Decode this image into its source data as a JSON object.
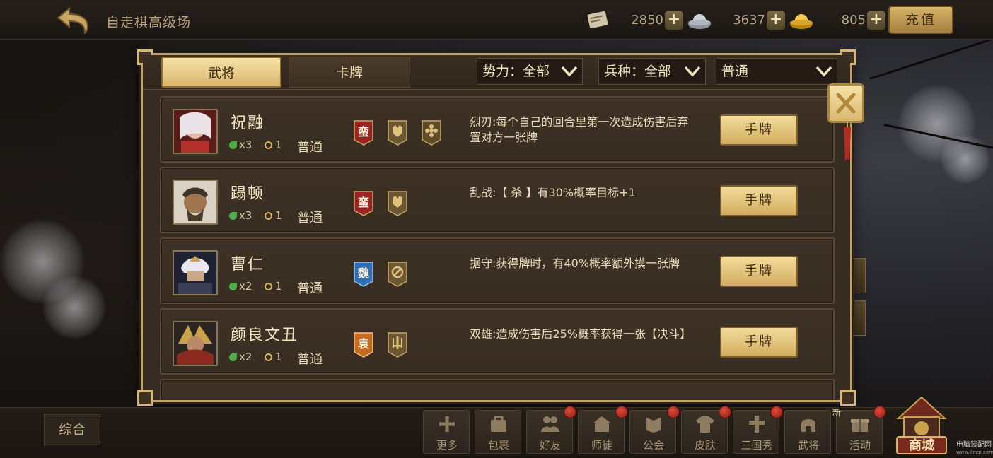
{
  "topbar": {
    "title": "自走棋高级场",
    "resources": [
      {
        "icon": "scroll-icon",
        "value": "2850"
      },
      {
        "icon": "silver-ingot-icon",
        "value": "3637"
      },
      {
        "icon": "gold-ingot-icon",
        "value": "805"
      }
    ],
    "recharge_label": "充值"
  },
  "panel": {
    "tabs": [
      {
        "label": "武将",
        "active": true
      },
      {
        "label": "卡牌",
        "active": false
      }
    ],
    "filters": {
      "faction": "势力：全部",
      "troop": "兵种：全部",
      "rarity": "普通"
    },
    "heroes": [
      {
        "name": "祝融",
        "count": "x3",
        "cost": "1",
        "rarity": "普通",
        "badges": [
          {
            "text": "蛮",
            "color": "#9a2424",
            "type": "faction"
          },
          {
            "text": "",
            "color": "#7a6336",
            "type": "beast-class-icon"
          },
          {
            "text": "",
            "color": "#6b5733",
            "type": "flower-class-icon"
          }
        ],
        "skill": "烈刃:每个自己的回合里第一次造成伤害后弃置对方一张牌",
        "button": "手牌",
        "portrait_color": "#b8453a"
      },
      {
        "name": "蹋顿",
        "count": "x3",
        "cost": "1",
        "rarity": "普通",
        "badges": [
          {
            "text": "蛮",
            "color": "#9a2424",
            "type": "faction"
          },
          {
            "text": "",
            "color": "#7a6336",
            "type": "beast-class-icon"
          }
        ],
        "skill": "乱战:【 杀 】有30%概率目标+1",
        "button": "手牌",
        "portrait_color": "#7c6a4a"
      },
      {
        "name": "曹仁",
        "count": "x2",
        "cost": "1",
        "rarity": "普通",
        "badges": [
          {
            "text": "魏",
            "color": "#2f6eb5",
            "type": "faction"
          },
          {
            "text": "",
            "color": "#7a6336",
            "type": "shield-class-icon"
          }
        ],
        "skill": "据守:获得牌时，有40%概率额外摸一张牌",
        "button": "手牌",
        "portrait_color": "#2f3550"
      },
      {
        "name": "颜良文丑",
        "count": "x2",
        "cost": "1",
        "rarity": "普通",
        "badges": [
          {
            "text": "袁",
            "color": "#c66a1e",
            "type": "faction"
          },
          {
            "text": "",
            "color": "#7a6336",
            "type": "sword-class-icon"
          }
        ],
        "skill": "双雄:造成伤害后25%概率获得一张【决斗】",
        "button": "手牌",
        "portrait_color": "#5a3a26"
      }
    ]
  },
  "bottombar": {
    "summary_label": "综合",
    "nav": [
      {
        "label": "更多",
        "icon": "plus-icon",
        "dot": false,
        "new": false
      },
      {
        "label": "包裹",
        "icon": "bag-icon",
        "dot": false,
        "new": false
      },
      {
        "label": "好友",
        "icon": "friends-icon",
        "dot": true,
        "new": false
      },
      {
        "label": "师徒",
        "icon": "mentor-icon",
        "dot": true,
        "new": false
      },
      {
        "label": "公会",
        "icon": "guild-icon",
        "dot": true,
        "new": false
      },
      {
        "label": "皮肤",
        "icon": "shirt-icon",
        "dot": true,
        "new": false
      },
      {
        "label": "三国秀",
        "icon": "figure-icon",
        "dot": true,
        "new": false
      },
      {
        "label": "武将",
        "icon": "helmet-icon",
        "dot": false,
        "new": false
      },
      {
        "label": "活动",
        "icon": "gift-icon",
        "dot": true,
        "new": true,
        "new_label": "新"
      }
    ],
    "shop_label": "商城"
  },
  "watermark": {
    "line1": "电脑装配网",
    "line2": "www.dnzp.com"
  },
  "colors": {
    "accent_gold": "#d9b66c",
    "panel_bg": "#362c22",
    "border_gold": "#c4a265"
  }
}
